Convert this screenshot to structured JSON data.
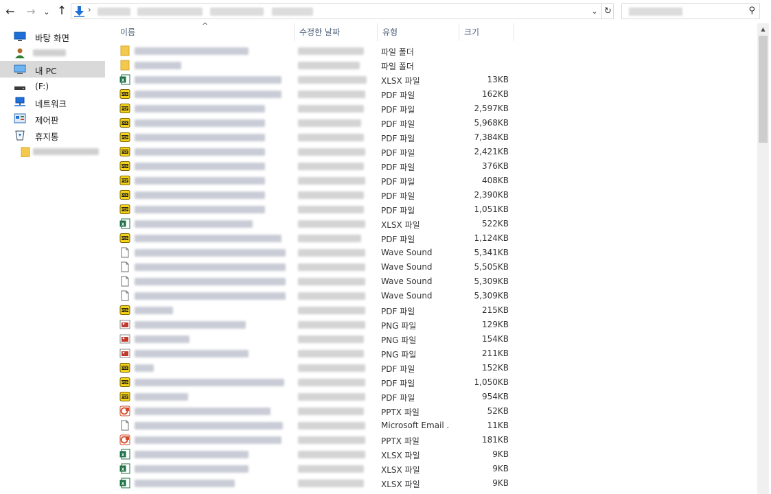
{
  "toolbar": {
    "back_icon": "back-arrow-icon",
    "forward_icon": "forward-arrow-icon",
    "recent_icon": "chevron-down-icon",
    "up_icon": "up-arrow-icon",
    "back_glyph": "←",
    "forward_glyph": "→",
    "recent_glyph": "⌄",
    "up_glyph": "↑",
    "address_chevron": "›",
    "address_drop_glyph": "⌄",
    "refresh_glyph": "↻",
    "search_glyph": "⚲"
  },
  "nav": {
    "items": [
      {
        "label": "바탕 화면",
        "icon": "desktop-icon"
      },
      {
        "label": "",
        "icon": "user-icon",
        "blurred": true
      },
      {
        "label": "내 PC",
        "icon": "computer-icon",
        "selected": true
      },
      {
        "label": "(F:)",
        "icon": "drive-icon"
      },
      {
        "label": "네트워크",
        "icon": "network-icon"
      },
      {
        "label": "제어판",
        "icon": "control-panel-icon"
      },
      {
        "label": "휴지통",
        "icon": "recycle-bin-icon"
      },
      {
        "label": "",
        "icon": "folder-icon",
        "blurred": true
      }
    ]
  },
  "columns": {
    "name": "이름",
    "modified": "수정한 날짜",
    "type": "유형",
    "size": "크기",
    "sort_glyph": "^"
  },
  "files": [
    {
      "icon": "folder-icon",
      "type": "파일 폴더",
      "size": ""
    },
    {
      "icon": "folder-icon",
      "type": "파일 폴더",
      "size": ""
    },
    {
      "icon": "excel-icon",
      "type": "XLSX 파일",
      "size": "13KB"
    },
    {
      "icon": "pdf-icon",
      "type": "PDF 파일",
      "size": "162KB"
    },
    {
      "icon": "pdf-icon",
      "type": "PDF 파일",
      "size": "2,597KB"
    },
    {
      "icon": "pdf-icon",
      "type": "PDF 파일",
      "size": "5,968KB"
    },
    {
      "icon": "pdf-icon",
      "type": "PDF 파일",
      "size": "7,384KB"
    },
    {
      "icon": "pdf-icon",
      "type": "PDF 파일",
      "size": "2,421KB"
    },
    {
      "icon": "pdf-icon",
      "type": "PDF 파일",
      "size": "376KB"
    },
    {
      "icon": "pdf-icon",
      "type": "PDF 파일",
      "size": "408KB"
    },
    {
      "icon": "pdf-icon",
      "type": "PDF 파일",
      "size": "2,390KB"
    },
    {
      "icon": "pdf-icon",
      "type": "PDF 파일",
      "size": "1,051KB"
    },
    {
      "icon": "excel-icon",
      "type": "XLSX 파일",
      "size": "522KB"
    },
    {
      "icon": "pdf-icon",
      "type": "PDF 파일",
      "size": "1,124KB"
    },
    {
      "icon": "wave-file-icon",
      "type": "Wave Sound",
      "size": "5,341KB"
    },
    {
      "icon": "wave-file-icon",
      "type": "Wave Sound",
      "size": "5,505KB"
    },
    {
      "icon": "wave-file-icon",
      "type": "Wave Sound",
      "size": "5,309KB"
    },
    {
      "icon": "wave-file-icon",
      "type": "Wave Sound",
      "size": "5,309KB"
    },
    {
      "icon": "pdf-icon",
      "type": "PDF 파일",
      "size": "215KB"
    },
    {
      "icon": "png-icon",
      "type": "PNG 파일",
      "size": "129KB"
    },
    {
      "icon": "png-icon",
      "type": "PNG 파일",
      "size": "154KB"
    },
    {
      "icon": "png-icon",
      "type": "PNG 파일",
      "size": "211KB"
    },
    {
      "icon": "pdf-icon",
      "type": "PDF 파일",
      "size": "152KB"
    },
    {
      "icon": "pdf-icon",
      "type": "PDF 파일",
      "size": "1,050KB"
    },
    {
      "icon": "pdf-icon",
      "type": "PDF 파일",
      "size": "954KB"
    },
    {
      "icon": "pptx-icon",
      "type": "PPTX 파일",
      "size": "52KB"
    },
    {
      "icon": "email-file-icon",
      "type": "Microsoft Email ...",
      "size": "11KB"
    },
    {
      "icon": "pptx-icon",
      "type": "PPTX 파일",
      "size": "181KB"
    },
    {
      "icon": "excel-icon",
      "type": "XLSX 파일",
      "size": "9KB"
    },
    {
      "icon": "excel-icon",
      "type": "XLSX 파일",
      "size": "9KB"
    },
    {
      "icon": "excel-icon",
      "type": "XLSX 파일",
      "size": "9KB"
    }
  ],
  "colors": {
    "selection": "#d9d9d9",
    "header_text": "#4c607a",
    "folder": "#f2c94c",
    "pdf": "#f5d21a",
    "excel": "#1e7145",
    "pptx": "#d24726",
    "download_arrow": "#1e6fd8"
  }
}
